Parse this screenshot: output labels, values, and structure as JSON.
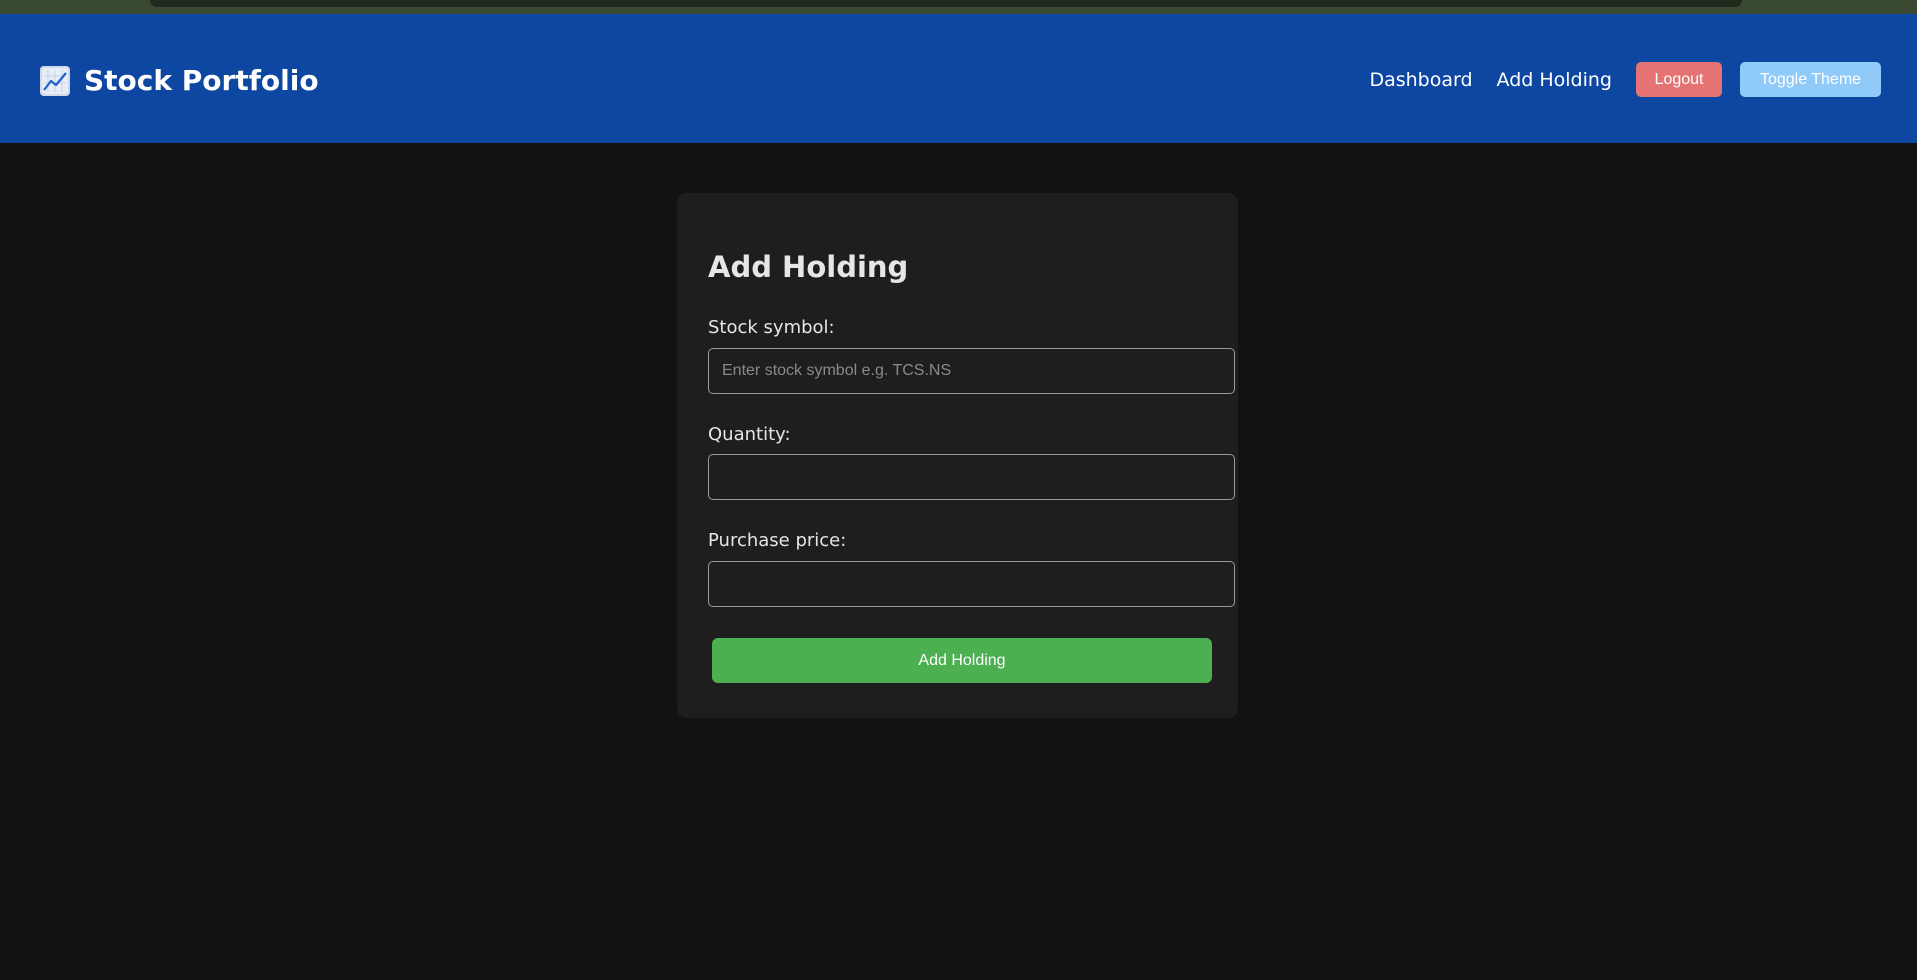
{
  "header": {
    "brand_icon": "chart-increasing-icon",
    "title": "Stock Portfolio",
    "nav": {
      "dashboard_label": "Dashboard",
      "add_holding_label": "Add Holding",
      "logout_label": "Logout",
      "toggle_theme_label": "Toggle Theme"
    }
  },
  "form": {
    "title": "Add Holding",
    "symbol_label": "Stock symbol:",
    "symbol_placeholder": "Enter stock symbol e.g. TCS.NS",
    "symbol_value": "",
    "quantity_label": "Quantity:",
    "quantity_value": "",
    "price_label": "Purchase price:",
    "price_value": "",
    "submit_label": "Add Holding"
  },
  "colors": {
    "navbar": "#0d47a1",
    "page_background": "#121212",
    "card_background": "#1e1e1e",
    "logout_button": "#e57373",
    "toggle_theme_button": "#90caf9",
    "submit_button": "#4caf50"
  }
}
